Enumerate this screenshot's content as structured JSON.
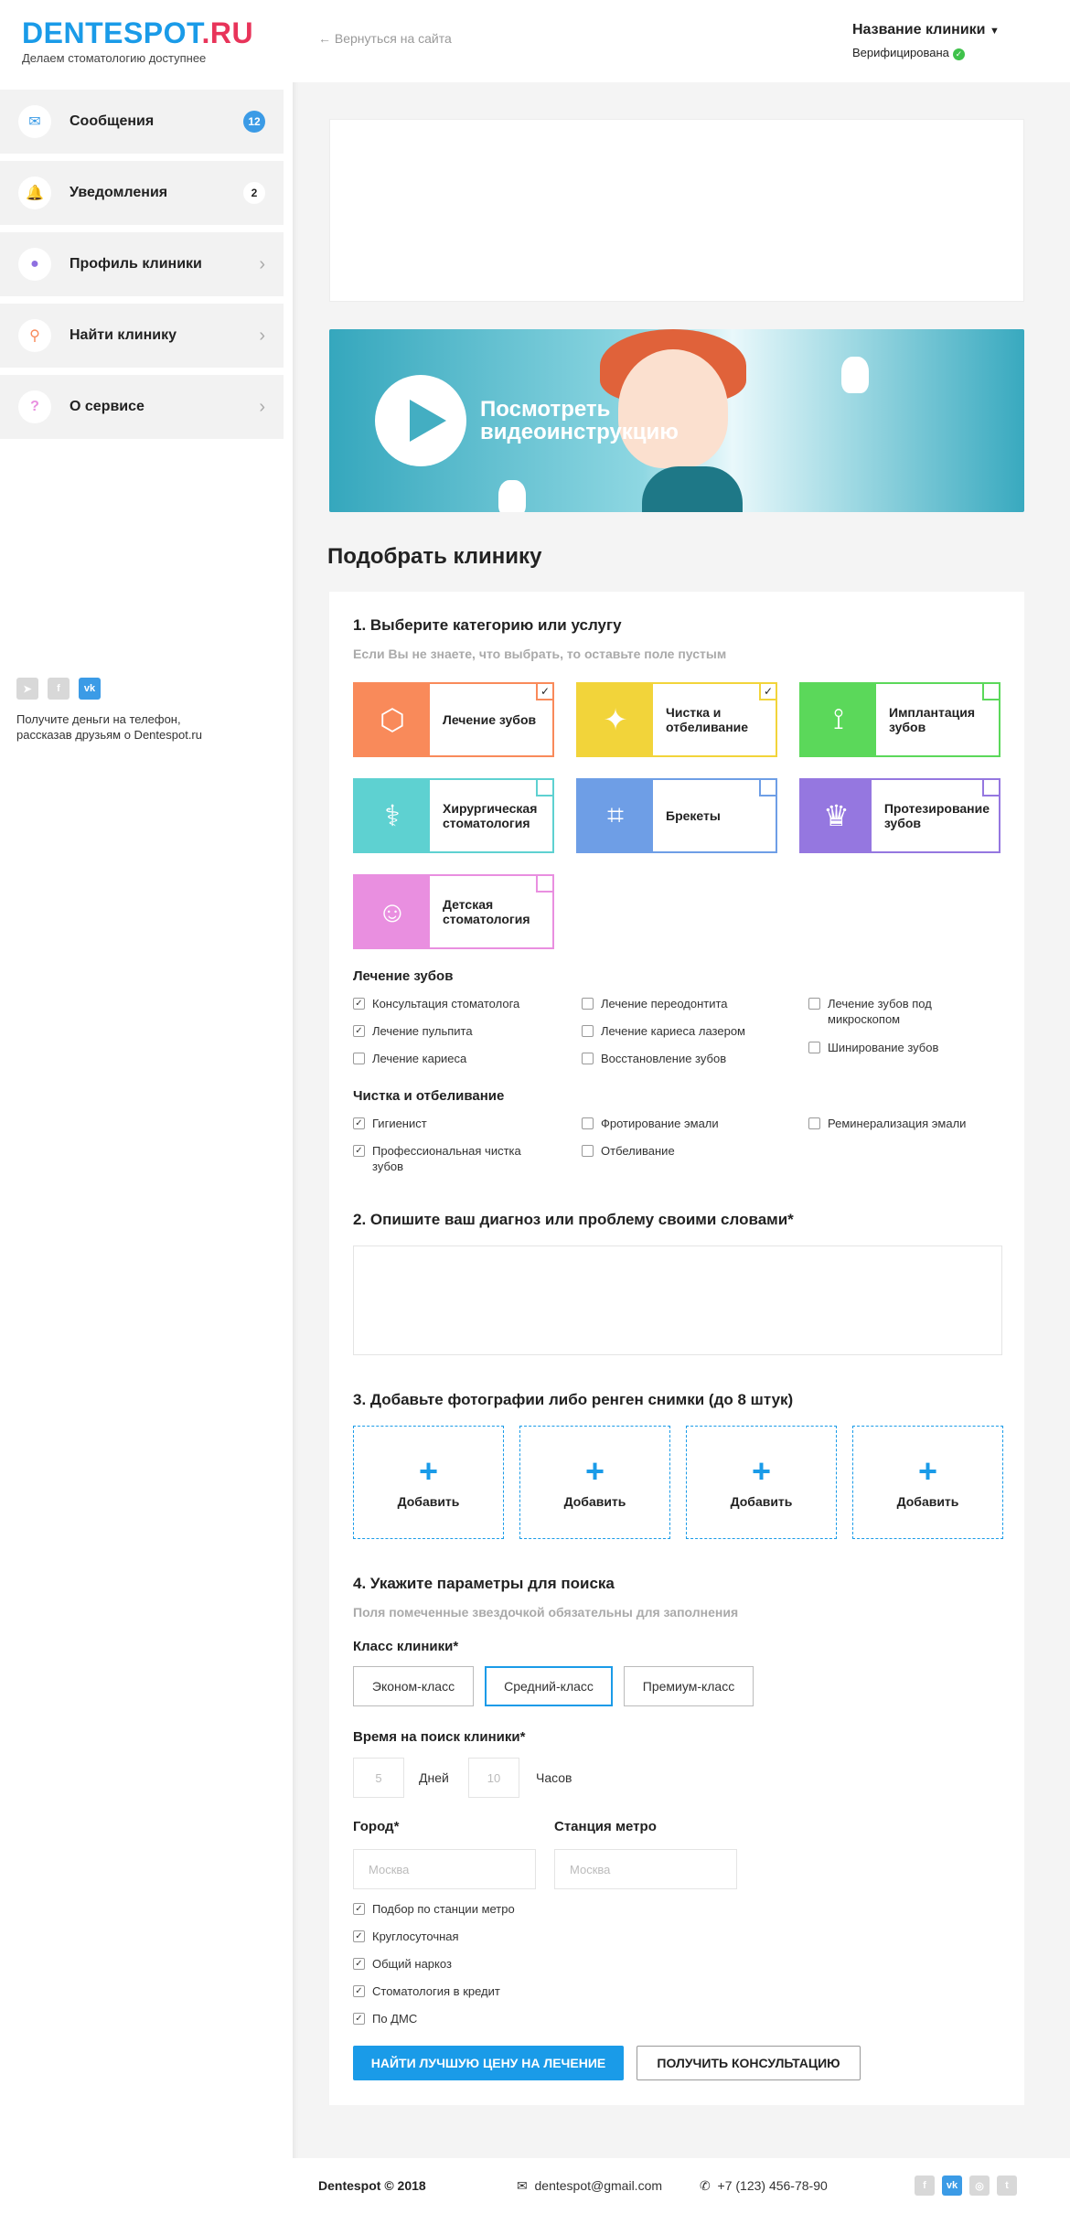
{
  "sidebar": {
    "logo_part1": "DENTESPOT",
    "logo_part2": ".RU",
    "tagline": "Делаем стоматологию доступнее",
    "items": [
      {
        "label": "Сообщения",
        "badge": "12",
        "icon": "envelope-icon"
      },
      {
        "label": "Уведомления",
        "badge": "2",
        "icon": "bell-icon"
      },
      {
        "label": "Профиль клиники",
        "icon": "user-icon"
      },
      {
        "label": "Найти клинику",
        "icon": "search-icon"
      },
      {
        "label": "О сервисе",
        "icon": "question-icon"
      }
    ],
    "social": [
      "telegram-icon",
      "facebook-icon",
      "vk-icon"
    ],
    "promo_text_line1": "Получите деньги на телефон,",
    "promo_text_line2": "рассказав друзьям о Dentespot.ru"
  },
  "header": {
    "back_link": "Вернуться на сайта",
    "clinic_name": "Название клиники",
    "status": "Верифицирована"
  },
  "video": {
    "line1": "Посмотреть",
    "line2": "видеоинструкцию"
  },
  "page_title": "Подобрать клинику",
  "step1": {
    "title": "1. Выберите категорию или услугу",
    "hint": "Если Вы не знаете, что выбрать, то оставьте поле пустым",
    "categories": [
      {
        "line1": "Лечение зубов",
        "line2": "",
        "color": "#f98a5a",
        "checked": true
      },
      {
        "line1": "Чистка и",
        "line2": "отбеливание",
        "color": "#f2d43a",
        "checked": true
      },
      {
        "line1": "Имплантация",
        "line2": "зубов",
        "color": "#5bd85a",
        "checked": false
      },
      {
        "line1": "Хирургическая",
        "line2": "стоматология",
        "color": "#5ed1d1",
        "checked": false
      },
      {
        "line1": "Брекеты",
        "line2": "",
        "color": "#6e9ee6",
        "checked": false
      },
      {
        "line1": "Протезирование",
        "line2": "зубов",
        "color": "#9577e0",
        "checked": false
      },
      {
        "line1": "Детская",
        "line2": "стоматология",
        "color": "#e98fe0",
        "checked": false
      }
    ],
    "group1_title": "Лечение зубов",
    "group1_items": [
      {
        "label": "Консультация стоматолога",
        "checked": true
      },
      {
        "label": "Лечение пульпита",
        "checked": true
      },
      {
        "label": "Лечение кариеса",
        "checked": false
      },
      {
        "label": "Лечение переодонтита",
        "checked": false
      },
      {
        "label": "Лечение кариеса лазером",
        "checked": false
      },
      {
        "label": "Восстановление зубов",
        "checked": false
      },
      {
        "label": "Лечение зубов под",
        "checked": false
      },
      {
        "label": "микроскопом",
        "checked": false
      },
      {
        "label": "Шинирование зубов",
        "checked": false
      }
    ],
    "group2_title": "Чистка и отбеливание",
    "group2_items": [
      {
        "label": "Гигиенист",
        "checked": true
      },
      {
        "label": "Профессиональная чистка",
        "checked": true
      },
      {
        "label": "зубов",
        "checked": false
      },
      {
        "label": "Фротирование эмали",
        "checked": false
      },
      {
        "label": "Отбеливание",
        "checked": false
      },
      {
        "label": "Реминерализация эмали",
        "checked": false
      }
    ]
  },
  "step2": {
    "title": "2. Опишите ваш диагноз или проблему своими словами*"
  },
  "step3": {
    "title": "3. Добавьте фотографии либо ренген снимки (до 8 штук)",
    "add_label": "Добавить"
  },
  "step4": {
    "title": "4. Укажите параметры для поиска",
    "hint": "Поля помеченные звездочкой обязательны для заполнения",
    "class_label": "Класс клиники*",
    "class_options": [
      "Эконом-класс",
      "Средний-класс",
      "Премиум-класс"
    ],
    "class_selected": "Средний-класс",
    "time_label": "Время на поиск клиники*",
    "days_placeholder": "5",
    "days_unit": "Дней",
    "hours_placeholder": "10",
    "hours_unit": "Часов",
    "city_label": "Город*",
    "city_placeholder": "Москва",
    "metro_label": "Станция метро",
    "metro_placeholder": "Москва",
    "options": [
      {
        "label": "Подбор по станции метро",
        "checked": true
      },
      {
        "label": "Круглосуточная",
        "checked": true
      },
      {
        "label": "Общий наркоз",
        "checked": true
      },
      {
        "label": "Стоматология в кредит",
        "checked": true
      },
      {
        "label": "По ДМС",
        "checked": true
      }
    ],
    "primary_button": "НАЙТИ ЛУЧШУЮ ЦЕНУ НА ЛЕЧЕНИЕ",
    "secondary_button": "ПОЛУЧИТЬ КОНСУЛЬТАЦИЮ"
  },
  "footer": {
    "copyright": "Dentespot © 2018",
    "email": "dentespot@gmail.com",
    "phone": "+7 (123) 456-78-90",
    "social": [
      "facebook-icon",
      "vk-icon",
      "instagram-icon",
      "twitter-icon"
    ]
  },
  "colors": {
    "accent": "#1a9be8",
    "brand_red": "#e8345a",
    "success": "#3fc24b"
  }
}
